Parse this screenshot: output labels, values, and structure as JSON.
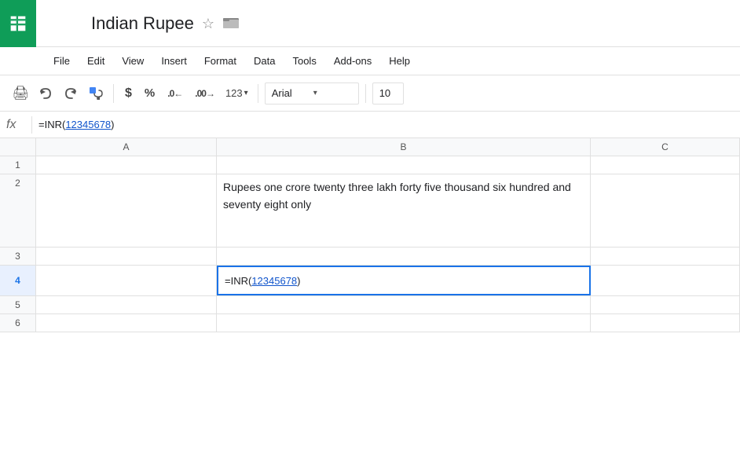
{
  "app": {
    "icon_color": "#0f9d58",
    "title": "Indian Rupee",
    "star_label": "☆",
    "folder_label": "📁"
  },
  "menu": {
    "items": [
      {
        "label": "File"
      },
      {
        "label": "Edit"
      },
      {
        "label": "View"
      },
      {
        "label": "Insert"
      },
      {
        "label": "Format"
      },
      {
        "label": "Data"
      },
      {
        "label": "Tools"
      },
      {
        "label": "Add-ons"
      },
      {
        "label": "Help"
      }
    ]
  },
  "toolbar": {
    "print_icon": "🖨",
    "undo_icon": "↺",
    "redo_icon": "↻",
    "paint_icon": "🖌",
    "dollar_label": "$",
    "percent_label": "%",
    "decimal_dec_label": ".0←",
    "decimal_inc_label": ".00→",
    "more_formats_label": "123",
    "font_name": "Arial",
    "font_size": "10"
  },
  "formula_bar": {
    "fx_label": "fx",
    "formula_prefix": "=INR(",
    "formula_link": "12345678",
    "formula_suffix": ")"
  },
  "columns": {
    "row_header": "",
    "a_label": "A",
    "b_label": "B",
    "c_label": "C"
  },
  "rows": [
    {
      "num": "1",
      "a": "",
      "b": "",
      "c": ""
    },
    {
      "num": "2",
      "a": "",
      "b": "Rupees one crore twenty three lakh forty five thousand six hundred and seventy eight only",
      "c": ""
    },
    {
      "num": "3",
      "a": "",
      "b": "",
      "c": ""
    },
    {
      "num": "4",
      "a": "",
      "b_prefix": "=INR(",
      "b_link": "12345678",
      "b_suffix": ")",
      "c": ""
    },
    {
      "num": "5",
      "a": "",
      "b": "",
      "c": ""
    },
    {
      "num": "6",
      "a": "",
      "b": "",
      "c": ""
    }
  ]
}
